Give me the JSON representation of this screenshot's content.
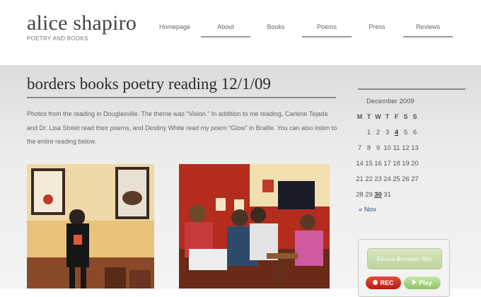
{
  "site": {
    "title": "alice shapiro",
    "tagline": "POETRY AND BOOKS"
  },
  "nav": [
    {
      "label": "Homepage"
    },
    {
      "label": "About"
    },
    {
      "label": "Books"
    },
    {
      "label": "Poems"
    },
    {
      "label": "Press"
    },
    {
      "label": "Reviews"
    }
  ],
  "post": {
    "title": "borders books poetry reading 12/1/09",
    "body": "Photos from the reading in Douglasville.  The theme was “Vision.”  In addition to me reading, Carlene Tejada and Dr. Lisa Street read their poems, and Destiny White read my poem “Glow” in Braille.  You can also listen to the entire reading below."
  },
  "calendar": {
    "caption": "December 2009",
    "weekdays": [
      "M",
      "T",
      "W",
      "T",
      "F",
      "S",
      "S"
    ],
    "weeks": [
      [
        "",
        "1",
        "2",
        "3",
        "4",
        "5",
        "6"
      ],
      [
        "7",
        "8",
        "9",
        "10",
        "11",
        "12",
        "13"
      ],
      [
        "14",
        "15",
        "16",
        "17",
        "18",
        "19",
        "20"
      ],
      [
        "21",
        "22",
        "23",
        "24",
        "25",
        "26",
        "27"
      ],
      [
        "28",
        "29",
        "30",
        "31",
        "",
        "",
        ""
      ]
    ],
    "prev_link": "« Nov"
  },
  "widget": {
    "title": "Evoca Browser Mic",
    "rec_label": "REC",
    "play_label": "Play"
  }
}
